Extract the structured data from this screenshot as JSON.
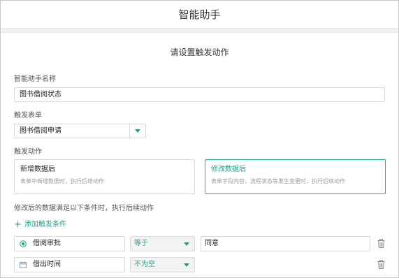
{
  "header": {
    "title": "智能助手"
  },
  "section": {
    "title": "请设置触发动作"
  },
  "name_field": {
    "label": "智能助手名称",
    "value": "图书借阅状态"
  },
  "form_field": {
    "label": "触发表单",
    "value": "图书借阅申请"
  },
  "action": {
    "label": "触发动作",
    "options": [
      {
        "title": "新增数据后",
        "desc": "表单中新增数据时，执行后续动作",
        "selected": false
      },
      {
        "title": "修改数据后",
        "desc": "表单字段内容、流程状态等发生变更时，执行后续动作",
        "selected": true
      }
    ]
  },
  "conditions": {
    "label": "修改后的数据满足以下条件时，执行后续动作",
    "add_label": "添加触发条件",
    "rows": [
      {
        "icon": "radio-icon",
        "field": "借阅审批",
        "operator": "等于",
        "value": "同意"
      },
      {
        "icon": "calendar-icon",
        "field": "借出时间",
        "operator": "不为空"
      }
    ]
  },
  "colors": {
    "accent": "#1aa38a",
    "border": "#d9d9d9"
  }
}
